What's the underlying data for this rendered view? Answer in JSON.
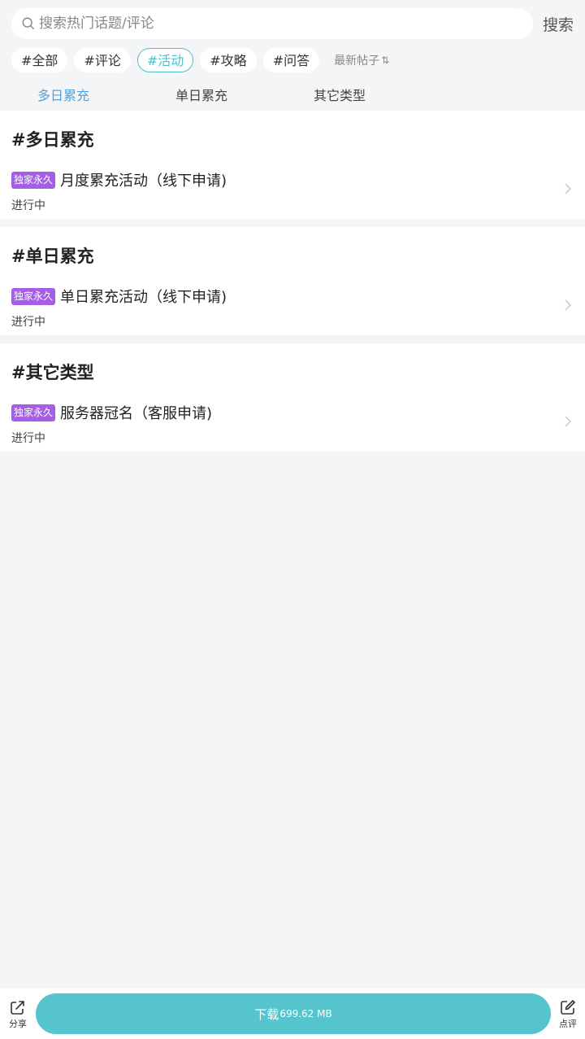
{
  "search": {
    "placeholder": "搜索热门话题/评论",
    "button": "搜索"
  },
  "tags": [
    "#全部",
    "#评论",
    "#活动",
    "#攻略",
    "#问答"
  ],
  "active_tag": "#活动",
  "sort_label": "最新帖子",
  "subtabs": [
    "多日累充",
    "单日累充",
    "其它类型"
  ],
  "sections": [
    {
      "title": "#多日累充",
      "badge": "独家永久",
      "item": "月度累充活动（线下申请)",
      "status": "进行中"
    },
    {
      "title": "#单日累充",
      "badge": "独家永久",
      "item": "单日累充活动（线下申请)",
      "status": "进行中"
    },
    {
      "title": "#其它类型",
      "badge": "独家永久",
      "item": "服务器冠名（客服申请)",
      "status": "进行中"
    }
  ],
  "bottom": {
    "share": "分享",
    "download": "下载",
    "size": "699.62 MB",
    "review": "点评"
  },
  "colors": {
    "accent": "#55c4cc",
    "badge": "#a55ee6",
    "subtab_active": "#4fa3d8"
  }
}
